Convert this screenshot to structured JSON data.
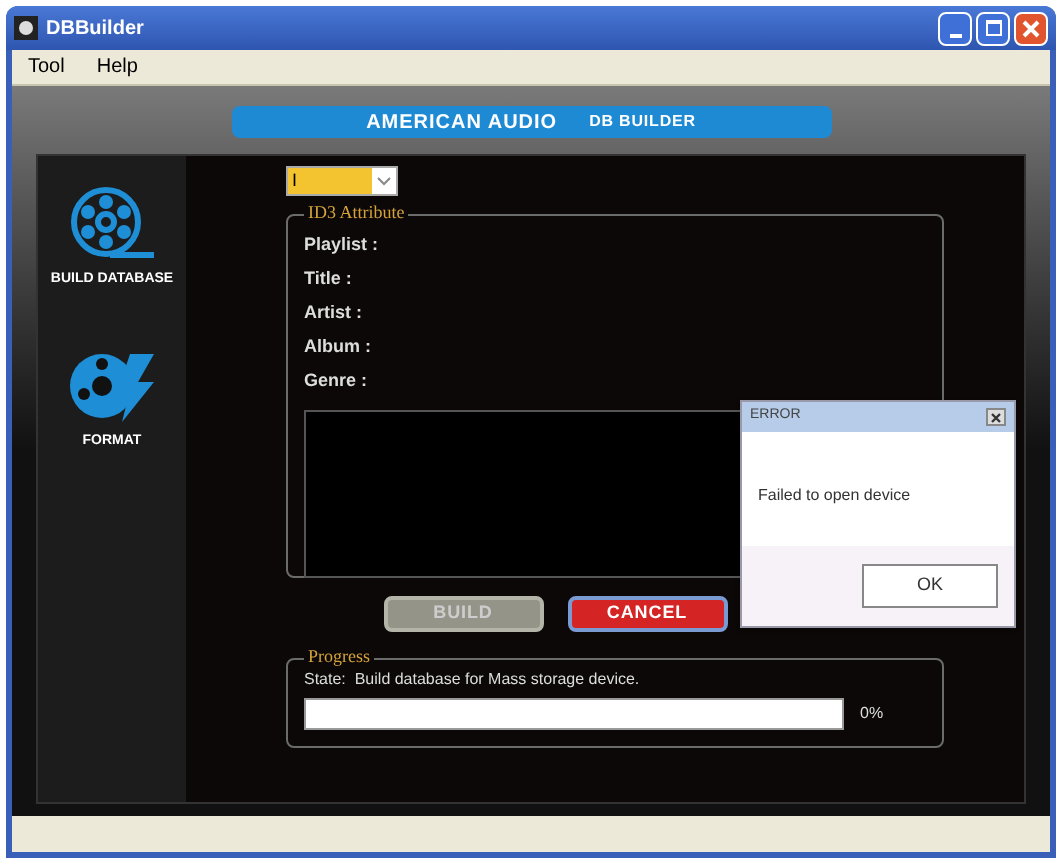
{
  "window": {
    "title": "DBBuilder"
  },
  "menu": [
    "Tool",
    "Help"
  ],
  "banner": {
    "brand": "AMERICAN AUDIO",
    "product": "DB BUILDER"
  },
  "sidebar": {
    "items": [
      {
        "kind": "build",
        "label": "BUILD DATABASE"
      },
      {
        "kind": "format",
        "label": "FORMAT"
      }
    ]
  },
  "drive_select": {
    "value": "I"
  },
  "id3": {
    "title": "ID3 Attribute",
    "fields": [
      "Playlist :",
      "Title :",
      "Artist :",
      "Album :",
      "Genre :"
    ]
  },
  "buttons": [
    {
      "kind": "build",
      "label": "BUILD",
      "disabled": true
    },
    {
      "kind": "cancel",
      "label": "CANCEL",
      "disabled": false
    }
  ],
  "progress": {
    "title": "Progress",
    "state": "State:  Build database for Mass storage device.",
    "level": 0,
    "reading": "0%"
  },
  "dialog": {
    "title": "ERROR",
    "message": "Failed to open device",
    "button": "OK"
  }
}
